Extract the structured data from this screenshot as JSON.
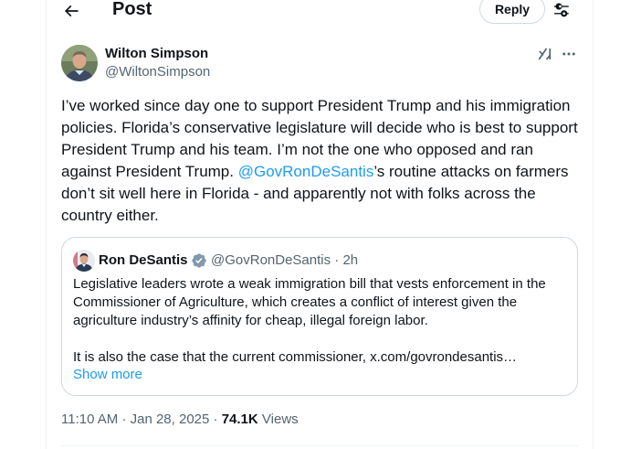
{
  "header": {
    "title": "Post",
    "reply_label": "Reply"
  },
  "post": {
    "author_name": "Wilton Simpson",
    "author_handle": "@WiltonSimpson",
    "text_part1": "I’ve worked since day one to support President Trump and his immigration policies. Florida’s conservative legislature will decide who is best to support President Trump and his team. I’m not the one who opposed and ran against President Trump. ",
    "mention": "@GovRonDeSantis",
    "text_part2": "’s routine attacks on farmers don’t sit well here in Florida - and apparently not with folks across the country either.",
    "time": "11:10 AM",
    "date": "Jan 28, 2025",
    "views_count": "74.1K",
    "views_label": "Views",
    "separator": "·"
  },
  "quote": {
    "author_name": "Ron DeSantis",
    "author_handle": "@GovRonDeSantis",
    "age": "2h",
    "para1": "Legislative leaders wrote a weak immigration bill that vests enforcement in the Commissioner of Agriculture, which creates a conflict of interest given the agriculture industry’s affinity for cheap, illegal foreign labor.",
    "para2": "It is also the case that the current commissioner, x.com/govrondesantis…",
    "show_more": "Show more"
  },
  "icons": {
    "back": "arrow-left-icon",
    "settings": "sliders-icon",
    "grok": "grok-icon",
    "more": "more-dots-icon",
    "verified": "verified-badge-icon"
  },
  "colors": {
    "link": "#1d9bf0",
    "secondary_text": "#536471",
    "primary_text": "#0f1419",
    "border": "#cfd9de",
    "verified_badge": "#829aab"
  }
}
